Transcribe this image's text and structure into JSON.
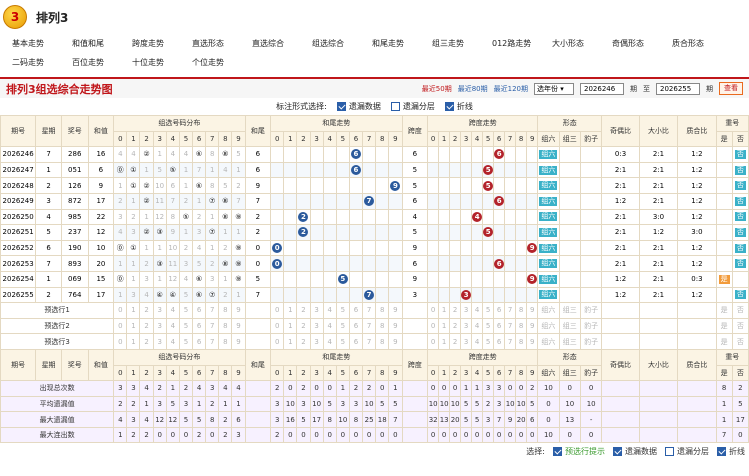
{
  "header": {
    "logo_text": "3",
    "title": "排列3"
  },
  "nav": {
    "row1": [
      "基本走势",
      "和值和尾",
      "跨度走势",
      "直选形态",
      "直选综合",
      "组选综合",
      "和尾走势",
      "组三走势",
      "012路走势",
      "大小形态",
      "奇偶形态",
      "质合形态"
    ],
    "row2": [
      "二码走势",
      "百位走势",
      "十位走势",
      "个位走势"
    ]
  },
  "toolbar": {
    "title": "排列3组选综合走势图",
    "links": [
      "最近50期",
      "最近80期",
      "最近120期"
    ],
    "select_value": "选年份",
    "from_value": "2026246",
    "from_label": "期",
    "to_label": "至",
    "to_value": "2026255",
    "to_suffix": "期",
    "query_label": "查看"
  },
  "options": {
    "label": "标注形式选择:",
    "items": [
      {
        "label": "遗漏数据",
        "checked": true
      },
      {
        "label": "遗漏分层",
        "checked": false
      },
      {
        "label": "折线",
        "checked": true
      }
    ]
  },
  "table": {
    "group_headers": {
      "issue": "期号",
      "weekday": "星期",
      "prize": "奖号",
      "sum": "和值",
      "group_dist": "组选号码分布",
      "tail": "和尾",
      "tail_trend": "和尾走势",
      "span": "跨度",
      "span_trend": "跨度走势",
      "shape": "形态",
      "odd": "奇偶比",
      "big": "大小比",
      "prime": "质合比",
      "repeat": "重号"
    },
    "digits": [
      "0",
      "1",
      "2",
      "3",
      "4",
      "5",
      "6",
      "7",
      "8",
      "9"
    ],
    "shape_cols": [
      "组六",
      "组三",
      "豹子"
    ],
    "repeat_cols": [
      "是",
      "否"
    ],
    "rows": [
      {
        "issue": "2026246",
        "week": "7",
        "prize": "286",
        "sum": "16",
        "tail": "6",
        "span": "6",
        "shape": "组六",
        "odd": "0:3",
        "big": "2:1",
        "prime": "1:2",
        "dist": [
          "4",
          "4",
          "②",
          "1",
          "4",
          "4",
          "⑥",
          "8",
          "⑧",
          "5"
        ],
        "tailbg": "6",
        "spanbg": "127",
        "repeat": "否"
      },
      {
        "issue": "2026247",
        "week": "1",
        "prize": "051",
        "sum": "6",
        "tail": "6",
        "span": "5",
        "shape": "组六",
        "odd": "2:1",
        "big": "2:1",
        "prime": "1:2",
        "dist": [
          "⓪",
          "①",
          "1",
          "5",
          "⑤",
          "1",
          "7",
          "1",
          "4",
          "1"
        ],
        "tailbg": "7",
        "spanbg": "128",
        "repeat": "否"
      },
      {
        "issue": "2026248",
        "week": "2",
        "prize": "126",
        "sum": "9",
        "tail": "9",
        "span": "5",
        "shape": "组六",
        "odd": "2:1",
        "big": "2:1",
        "prime": "1:2",
        "dist": [
          "1",
          "①",
          "②",
          "10",
          "6",
          "1",
          "⑥",
          "8",
          "5",
          "2"
        ],
        "tailbg": "8",
        "spanbg": "129",
        "repeat": "否"
      },
      {
        "issue": "2026249",
        "week": "3",
        "prize": "872",
        "sum": "17",
        "tail": "7",
        "span": "6",
        "shape": "组六",
        "odd": "1:2",
        "big": "2:1",
        "prime": "1:2",
        "dist": [
          "2",
          "1",
          "②",
          "11",
          "7",
          "2",
          "1",
          "⑦",
          "⑧",
          "7"
        ],
        "tailbg": "9",
        "spanbg": "130",
        "repeat": "否"
      },
      {
        "issue": "2026250",
        "week": "4",
        "prize": "985",
        "sum": "22",
        "tail": "2",
        "span": "4",
        "shape": "组六",
        "odd": "2:1",
        "big": "3:0",
        "prime": "1:2",
        "dist": [
          "3",
          "2",
          "1",
          "12",
          "8",
          "⑤",
          "2",
          "1",
          "⑧",
          "⑨"
        ],
        "tailbg": "10",
        "spanbg": "131",
        "repeat": "否"
      },
      {
        "issue": "2026251",
        "week": "5",
        "prize": "237",
        "sum": "12",
        "tail": "2",
        "span": "5",
        "shape": "组六",
        "odd": "2:1",
        "big": "1:2",
        "prime": "3:0",
        "dist": [
          "4",
          "3",
          "②",
          "③",
          "9",
          "1",
          "3",
          "⑦",
          "1",
          "1"
        ],
        "tailbg": "11",
        "spanbg": "132",
        "repeat": "否"
      },
      {
        "issue": "2026252",
        "week": "6",
        "prize": "190",
        "sum": "10",
        "tail": "0",
        "span": "9",
        "shape": "组六",
        "odd": "2:1",
        "big": "2:1",
        "prime": "1:2",
        "dist": [
          "⓪",
          "①",
          "1",
          "1",
          "10",
          "2",
          "4",
          "1",
          "2",
          "⑨"
        ],
        "tailbg": "12",
        "spanbg": "133",
        "repeat": "否"
      },
      {
        "issue": "2026253",
        "week": "7",
        "prize": "893",
        "sum": "20",
        "tail": "0",
        "span": "6",
        "shape": "组六",
        "odd": "2:1",
        "big": "2:1",
        "prime": "1:2",
        "dist": [
          "1",
          "1",
          "2",
          "③",
          "11",
          "3",
          "5",
          "2",
          "⑧",
          "⑨"
        ],
        "tailbg": "13",
        "spanbg": "134",
        "repeat": "否"
      },
      {
        "issue": "2026254",
        "week": "1",
        "prize": "069",
        "sum": "15",
        "tail": "5",
        "span": "9",
        "shape": "组六",
        "odd": "1:2",
        "big": "2:1",
        "prime": "0:3",
        "dist": [
          "⓪",
          "1",
          "3",
          "1",
          "12",
          "4",
          "⑥",
          "3",
          "1",
          "⑨"
        ],
        "tailbg": "14",
        "spanbg": "135",
        "repeat": "是"
      },
      {
        "issue": "2026255",
        "week": "2",
        "prize": "764",
        "sum": "17",
        "tail": "7",
        "span": "3",
        "shape": "组六",
        "odd": "1:2",
        "big": "2:1",
        "prime": "1:2",
        "dist": [
          "1",
          "3",
          "4",
          "④",
          "④",
          "5",
          "⑥",
          "⑦",
          "2",
          "1"
        ],
        "tailbg": "15",
        "spanbg": "136",
        "repeat": "否"
      }
    ],
    "tail_marks": [
      6,
      6,
      9,
      7,
      2,
      2,
      0,
      0,
      5,
      7
    ],
    "span_marks": [
      6,
      5,
      5,
      6,
      4,
      5,
      9,
      6,
      9,
      3
    ],
    "predict_rows": [
      "预选行1",
      "预选行2",
      "预选行3"
    ],
    "stats": [
      {
        "label": "出现总次数",
        "dist": [
          "3",
          "3",
          "4",
          "2",
          "1",
          "2",
          "4",
          "3",
          "4",
          "4"
        ],
        "tail": [
          "2",
          "0",
          "2",
          "0",
          "0",
          "1",
          "2",
          "2",
          "0",
          "1"
        ],
        "span": [
          "0",
          "0",
          "0",
          "1",
          "1",
          "3",
          "3",
          "0",
          "0",
          "2"
        ],
        "shape": [
          "10",
          "0",
          "0"
        ],
        "repeat": [
          "8",
          "2"
        ]
      },
      {
        "label": "平均遗漏值",
        "dist": [
          "2",
          "2",
          "1",
          "3",
          "5",
          "3",
          "1",
          "2",
          "1",
          "1"
        ],
        "tail": [
          "3",
          "10",
          "3",
          "10",
          "5",
          "3",
          "3",
          "10",
          "5",
          "5"
        ],
        "span": [
          "10",
          "10",
          "10",
          "5",
          "5",
          "2",
          "3",
          "10",
          "10",
          "5"
        ],
        "shape": [
          "0",
          "10",
          "10"
        ],
        "repeat": [
          "1",
          "5"
        ]
      },
      {
        "label": "最大遗漏值",
        "dist": [
          "4",
          "3",
          "4",
          "12",
          "12",
          "5",
          "5",
          "8",
          "2",
          "6"
        ],
        "tail": [
          "3",
          "16",
          "5",
          "17",
          "8",
          "10",
          "8",
          "25",
          "18",
          "7"
        ],
        "span": [
          "32",
          "13",
          "20",
          "5",
          "5",
          "3",
          "7",
          "9",
          "20",
          "6"
        ],
        "shape": [
          "0",
          "13",
          "-"
        ],
        "repeat": [
          "1",
          "17"
        ]
      },
      {
        "label": "最大连出数",
        "dist": [
          "1",
          "2",
          "2",
          "0",
          "0",
          "0",
          "2",
          "0",
          "2",
          "3"
        ],
        "tail": [
          "2",
          "0",
          "0",
          "0",
          "0",
          "0",
          "0",
          "0",
          "0",
          "0"
        ],
        "span": [
          "0",
          "0",
          "0",
          "0",
          "0",
          "0",
          "0",
          "0",
          "0",
          "0"
        ],
        "shape": [
          "10",
          "0",
          "0"
        ],
        "repeat": [
          "7",
          "0"
        ]
      }
    ]
  },
  "footer": {
    "label": "选择:",
    "items": [
      {
        "label": "预选行提示",
        "checked": true
      },
      {
        "label": "遗漏数据",
        "checked": true
      },
      {
        "label": "遗漏分层",
        "checked": false
      },
      {
        "label": "折线",
        "checked": true
      }
    ]
  },
  "colors": {
    "accent": "#c0161a",
    "blue_ball": "#2b5a9c",
    "red_ball": "#b3232a",
    "tag": "#3ab1c8"
  }
}
